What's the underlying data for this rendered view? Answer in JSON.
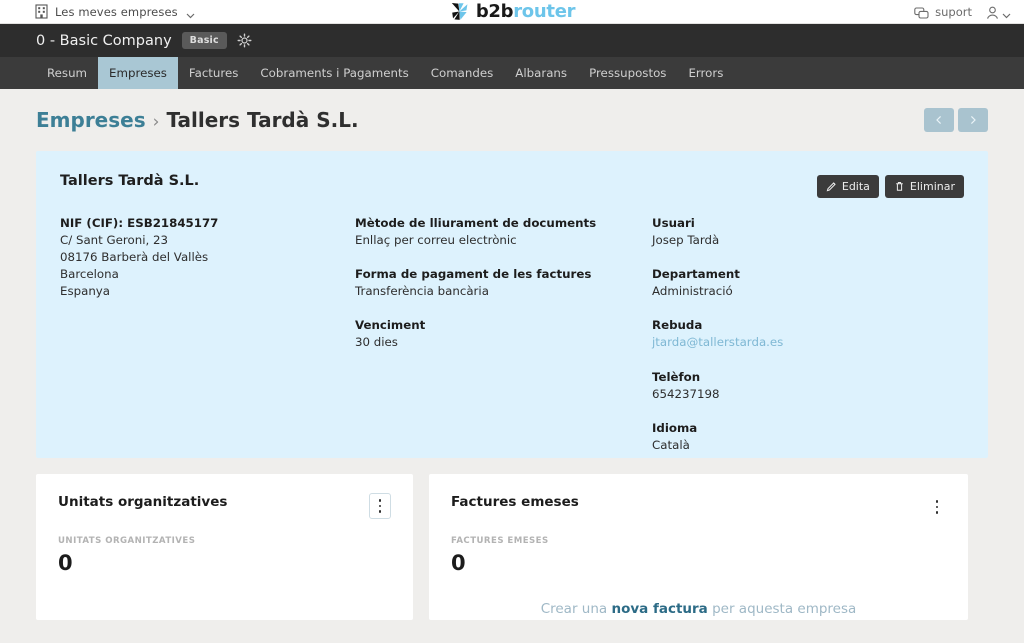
{
  "topbar": {
    "companies_switcher": "Les meves empreses",
    "companies_icon": "building-icon",
    "chevron_icon": "chevron-down-icon",
    "logo": {
      "part1": "b2b",
      "part2": "router",
      "icon": "b2brouter-pinwheel-logo",
      "color_part2": "#6dc5ea"
    },
    "support_label": "suport",
    "support_icon": "chat-bubbles-icon",
    "user_icon": "user-avatar-icon",
    "user_chevron_icon": "chevron-down-icon"
  },
  "company_bar": {
    "name": "0 - Basic Company",
    "plan_badge": "Basic",
    "settings_icon": "gear-icon"
  },
  "nav": {
    "tabs": [
      {
        "label": "Resum",
        "active": false
      },
      {
        "label": "Empreses",
        "active": true
      },
      {
        "label": "Factures",
        "active": false
      },
      {
        "label": "Cobraments i Pagaments",
        "active": false
      },
      {
        "label": "Comandes",
        "active": false
      },
      {
        "label": "Albarans",
        "active": false
      },
      {
        "label": "Pressupostos",
        "active": false
      },
      {
        "label": "Errors",
        "active": false
      }
    ],
    "active_bg": "#a9c7d4"
  },
  "breadcrumb": {
    "parent": "Empreses",
    "separator": "›",
    "current": "Tallers Tardà S.L.",
    "link_color": "#3d7f96"
  },
  "pager": {
    "prev_icon": "chevron-left-icon",
    "prev_glyph": "‹",
    "next_icon": "chevron-right-icon",
    "next_glyph": "›"
  },
  "info_card": {
    "background": "#ddf2fd",
    "title": "Tallers Tardà S.L.",
    "actions": {
      "edit_label": "Edita",
      "edit_icon": "pencil-icon",
      "delete_label": "Eliminar",
      "delete_icon": "trash-icon"
    },
    "column_1": {
      "nif_label": "NIF (CIF):",
      "nif_value": "ESB21845177",
      "address_lines": [
        "C/ Sant Geroni, 23",
        "08176 Barberà del Vallès",
        "Barcelona",
        "Espanya"
      ]
    },
    "column_2": [
      {
        "label": "Mètode de lliurament de documents",
        "value": "Enllaç per correu electrònic"
      },
      {
        "label": "Forma de pagament de les factures",
        "value": "Transferència bancària"
      },
      {
        "label": "Venciment",
        "value": "30 dies"
      }
    ],
    "column_3": [
      {
        "label": "Usuari",
        "value": "Josep Tardà",
        "is_link": false
      },
      {
        "label": "Departament",
        "value": "Administració",
        "is_link": false
      },
      {
        "label": "Rebuda",
        "value": "jtarda@tallerstarda.es",
        "is_link": true
      },
      {
        "label": "Telèfon",
        "value": "654237198",
        "is_link": false
      },
      {
        "label": "Idioma",
        "value": "Català",
        "is_link": false
      }
    ]
  },
  "cards": {
    "org_units": {
      "title": "Unitats organitzatives",
      "stat_label": "UNITATS ORGANITZATIVES",
      "stat_value": "0",
      "menu_icon": "kebab-menu-icon"
    },
    "issued_invoices": {
      "title": "Factures emeses",
      "stat_label": "FACTURES EMESES",
      "stat_value": "0",
      "menu_icon": "kebab-menu-icon",
      "cta_prefix": "Crear una ",
      "cta_bold": "nova factura",
      "cta_suffix": " per aquesta empresa"
    }
  }
}
